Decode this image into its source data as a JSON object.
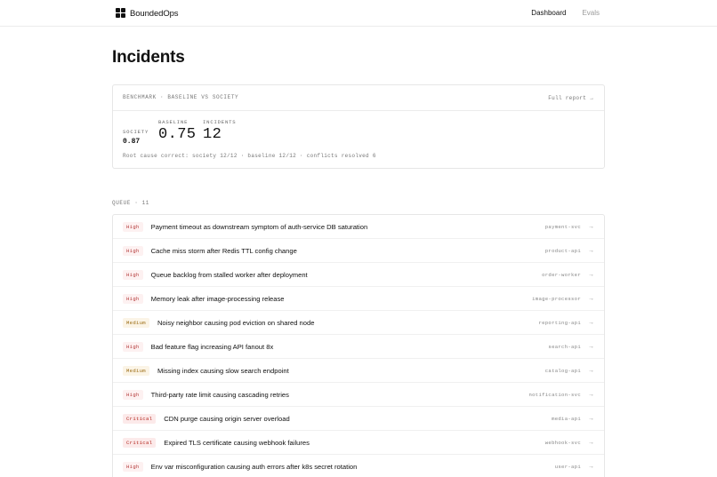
{
  "header": {
    "brand": "BoundedOps",
    "nav": {
      "dashboard": "Dashboard",
      "evals": "Evals"
    }
  },
  "page": {
    "title": "Incidents"
  },
  "benchmark": {
    "label": "BENCHMARK · BASELINE VS SOCIETY",
    "full_report": "Full report →",
    "society_label": "SOCIETY",
    "society_value": "0.87",
    "baseline_label": "BASELINE",
    "baseline_value": "0.75",
    "incidents_label": "INCIDENTS",
    "incidents_value": "12",
    "summary": "Root cause correct: society 12/12 · baseline 12/12 · conflicts resolved 6"
  },
  "queue": {
    "label": "QUEUE · 11",
    "items": [
      {
        "severity": "High",
        "title": "Payment timeout as downstream symptom of auth-service DB saturation",
        "service": "payment-svc"
      },
      {
        "severity": "High",
        "title": "Cache miss storm after Redis TTL config change",
        "service": "product-api"
      },
      {
        "severity": "High",
        "title": "Queue backlog from stalled worker after deployment",
        "service": "order-worker"
      },
      {
        "severity": "High",
        "title": "Memory leak after image-processing release",
        "service": "image-processor"
      },
      {
        "severity": "Medium",
        "title": "Noisy neighbor causing pod eviction on shared node",
        "service": "reporting-api"
      },
      {
        "severity": "High",
        "title": "Bad feature flag increasing API fanout 8x",
        "service": "search-api"
      },
      {
        "severity": "Medium",
        "title": "Missing index causing slow search endpoint",
        "service": "catalog-api"
      },
      {
        "severity": "High",
        "title": "Third-party rate limit causing cascading retries",
        "service": "notification-svc"
      },
      {
        "severity": "Critical",
        "title": "CDN purge causing origin server overload",
        "service": "media-api"
      },
      {
        "severity": "Critical",
        "title": "Expired TLS certificate causing webhook failures",
        "service": "webhook-svc"
      },
      {
        "severity": "High",
        "title": "Env var misconfiguration causing auth errors after k8s secret rotation",
        "service": "user-api"
      }
    ],
    "arrow_glyph": "→"
  }
}
